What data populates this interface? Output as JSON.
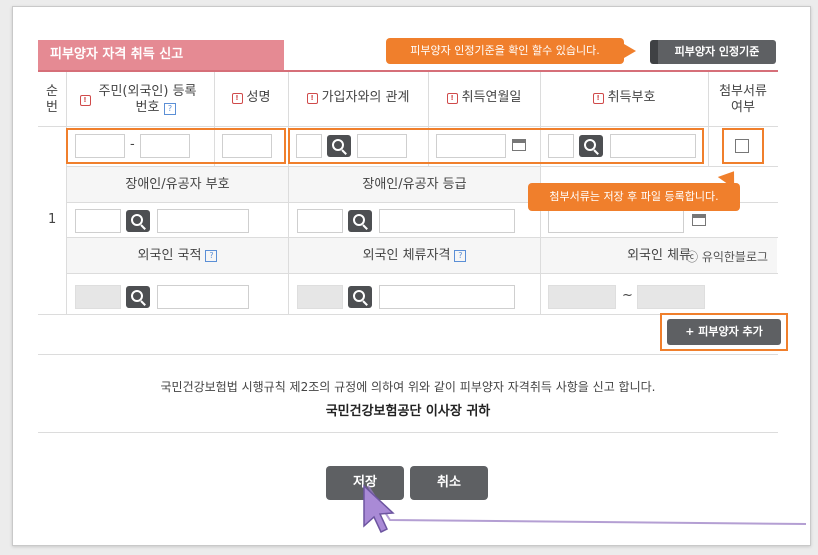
{
  "form": {
    "title": "피부양자 자격 취득 신고",
    "criteria_button": "피부양자 인정기준",
    "criteria_callout": "피부양자 인정기준을 확인 할수 있습니다.",
    "attach_callout": "첨부서류는 저장 후 파일 등록합니다."
  },
  "table": {
    "headers": {
      "seq": "순번",
      "id_number": "주민(외국인) 등록번호",
      "name": "성명",
      "relation": "가입자와의 관계",
      "acq_date": "취득연월일",
      "acq_code": "취득부호",
      "attachment": "첨부서류 여부"
    },
    "row_number": "1",
    "id_separator": "-",
    "sub_headers": {
      "disabled_code": "장애인/유공자 부호",
      "disabled_grade": "장애인/유공자 등급",
      "nationality": "외국인 국적",
      "stay_status": "외국인 체류자격",
      "stay_period": "외국인 체류"
    },
    "range_separator": "~"
  },
  "actions": {
    "add_dependent": "+ 피부양자 추가",
    "save": "저장",
    "cancel": "취소"
  },
  "notice": {
    "line1": "국민건강보험법 시행규칙 제2조의 규정에 의하여 위와 같이 피부양자 자격취득 사항을 신고 합니다.",
    "line2": "국민건강보험공단 이사장 귀하"
  },
  "watermark": "ⓒ 유익한블로그",
  "colors": {
    "title_pink": "#e58a93",
    "highlight_orange": "#f07f2c",
    "button_dark": "#5e6063",
    "cursor_purple": "#9b7fc4"
  }
}
